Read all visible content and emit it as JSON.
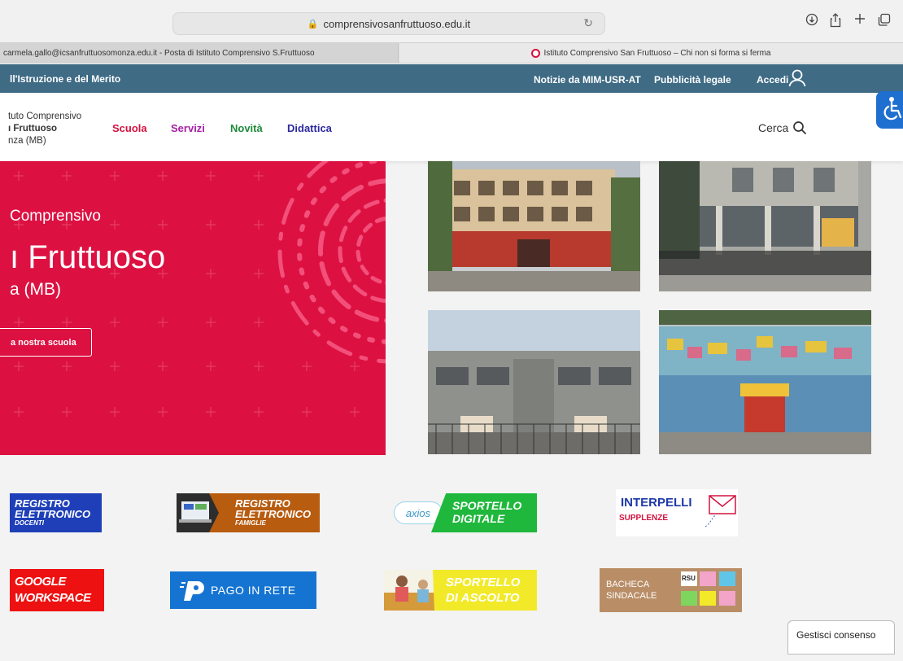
{
  "browser": {
    "url": "comprensivosanfruttuoso.edu.it",
    "tabs": [
      {
        "label": "carmela.gallo@icsanfruttuosomonza.edu.it - Posta di Istituto Comprensivo S.Fruttuoso"
      },
      {
        "label": "Istituto Comprensivo San Fruttuoso – Chi non si forma si ferma"
      }
    ],
    "icons": [
      "lock-icon",
      "reload-icon",
      "download-icon",
      "share-icon",
      "new-tab-icon",
      "tabs-overview-icon"
    ]
  },
  "topbar": {
    "ministry": "ll'Istruzione e del Merito",
    "links": [
      "Notizie da MIM-USR-AT",
      "Pubblicità legale"
    ],
    "login": "Accedi",
    "color": "#3f6b85"
  },
  "header": {
    "logo_line1": "tuto Comprensivo",
    "logo_line2": "ı Fruttuoso",
    "logo_line3": "nza (MB)",
    "nav": [
      {
        "label": "Scuola",
        "color": "#d3123f"
      },
      {
        "label": "Servizi",
        "color": "#a51ea5"
      },
      {
        "label": "Novità",
        "color": "#1f8a3c"
      },
      {
        "label": "Didattica",
        "color": "#2c2a9e"
      }
    ],
    "search_label": "Cerca"
  },
  "hero": {
    "kicker": "Comprensivo",
    "name": "ı Fruttuoso",
    "city": "a (MB)",
    "button": "a nostra scuola",
    "color": "#dc1142"
  },
  "banners": {
    "registro_docenti": {
      "line1": "REGISTRO",
      "line2": "ELETTRONICO",
      "sub": "DOCENTI"
    },
    "registro_famiglie": {
      "line1": "REGISTRO",
      "line2": "ELETTRONICO",
      "sub": "FAMIGLIE"
    },
    "sportello_digitale": {
      "brand": "axios",
      "line1": "SPORTELLO",
      "line2": "DIGITALE"
    },
    "interpelli": {
      "line1": "INTERPELLI",
      "line2": "SUPPLENZE"
    },
    "google": {
      "line1": "GOOGLE",
      "line2": "WORKSPACE"
    },
    "pago": {
      "label": "PAGO IN RETE"
    },
    "ascolto": {
      "line1": "SPORTELLO",
      "line2": "DI ASCOLTO"
    },
    "bacheca": {
      "line1": "BACHECA",
      "line2": "SINDACALE",
      "tag": "RSU"
    }
  },
  "consent": {
    "label": "Gestisci consenso"
  }
}
